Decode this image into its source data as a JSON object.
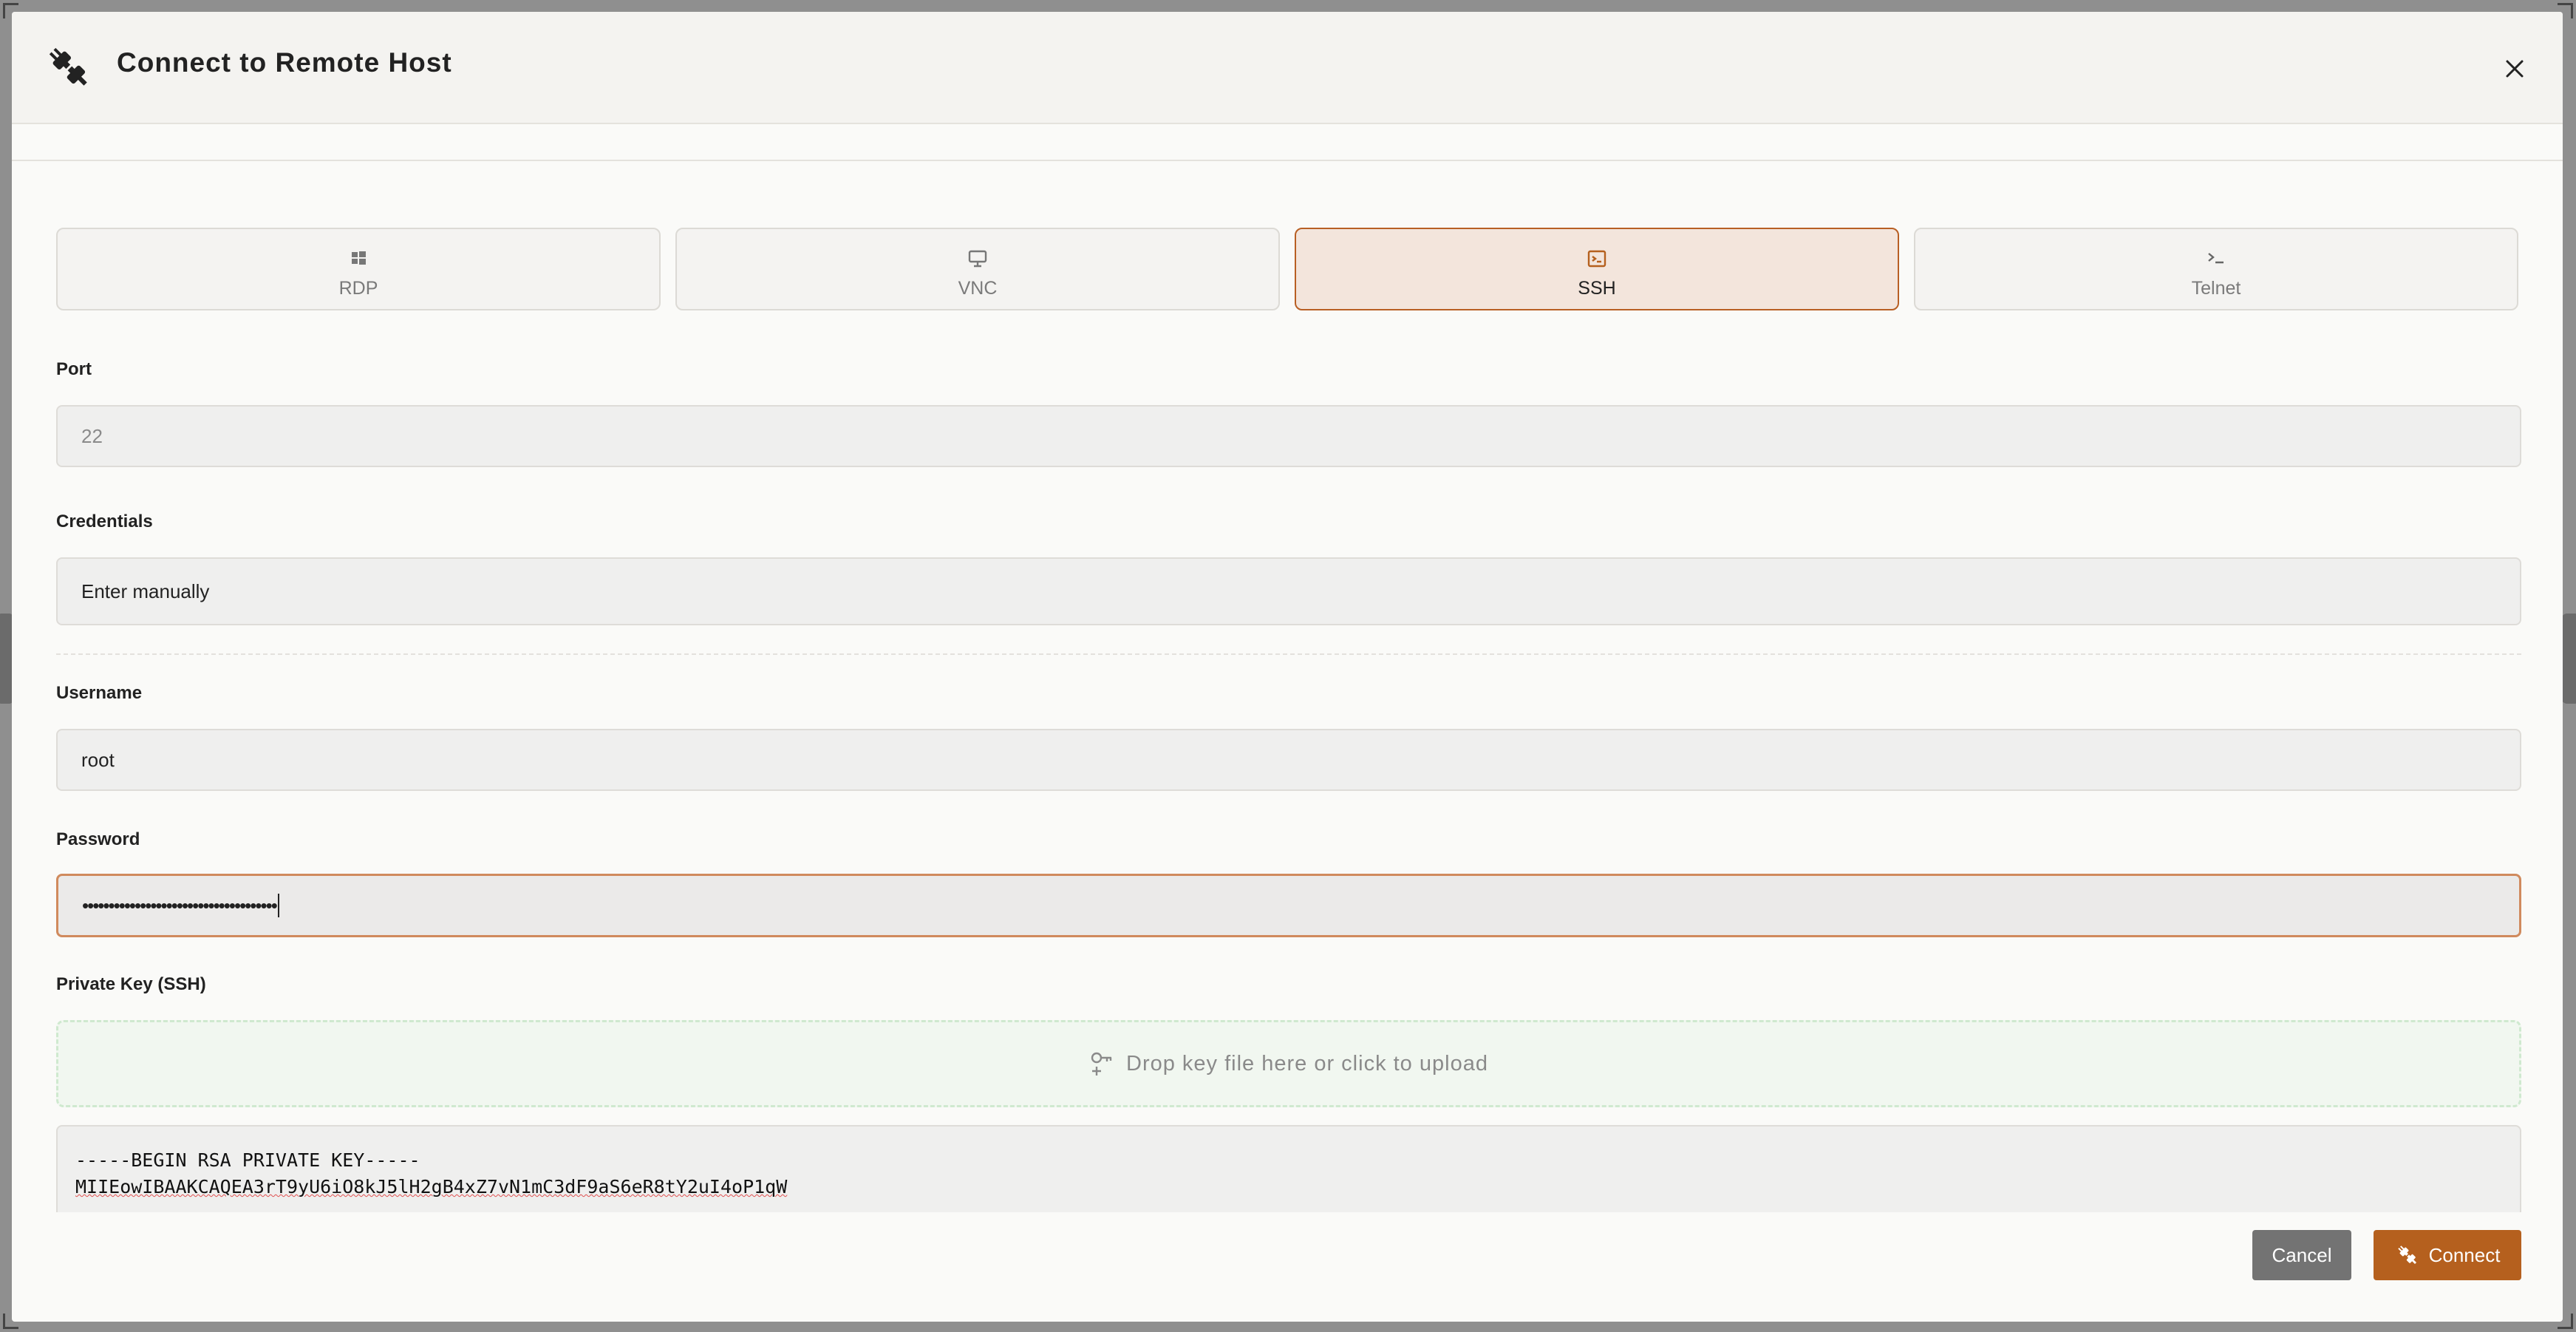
{
  "dialog": {
    "title": "Connect to Remote Host",
    "icons": {
      "header": "plug-icon",
      "close": "close-icon"
    }
  },
  "protocols": [
    {
      "label": "RDP",
      "icon": "windows-icon",
      "active": false
    },
    {
      "label": "VNC",
      "icon": "monitor-icon",
      "active": false
    },
    {
      "label": "SSH",
      "icon": "terminal-icon",
      "active": true
    },
    {
      "label": "Telnet",
      "icon": "prompt-icon",
      "active": false
    }
  ],
  "form": {
    "port": {
      "label": "Port",
      "placeholder": "22"
    },
    "credentials": {
      "label": "Credentials",
      "value": "Enter manually"
    },
    "username": {
      "label": "Username",
      "value": "root"
    },
    "password": {
      "label": "Password",
      "value": "•••••••••••••••••••••••••••••••••••••"
    },
    "private_key": {
      "label": "Private Key (SSH)",
      "dropzone_text": "Drop key file here or click to upload",
      "line1": "-----BEGIN RSA PRIVATE KEY-----",
      "line2": "MIIEowIBAAKCAQEA3rT9yU6iO8kJ5lH2gB4xZ7vN1mC3dF9aS6eR8tY2uI4oP1qW"
    }
  },
  "footer": {
    "cancel_label": "Cancel",
    "connect_label": "Connect"
  },
  "colors": {
    "accent": "#b5601e",
    "active_bg": "#f3e5dc",
    "dropzone_border": "#cfe9cf"
  }
}
